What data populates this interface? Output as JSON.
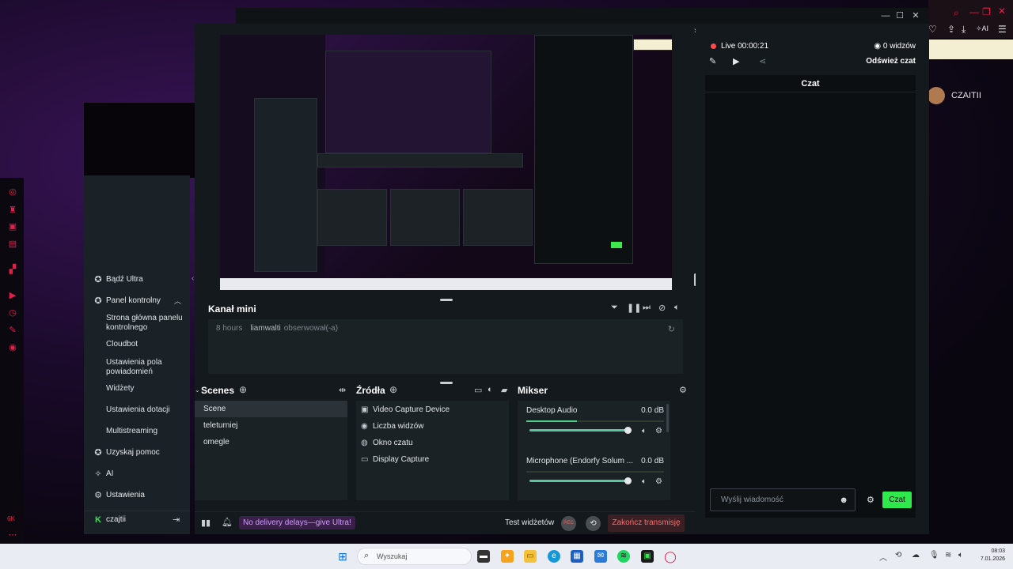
{
  "sidebar": {
    "items": [
      {
        "icon": "ultra-icon",
        "label": "Bądź Ultra"
      },
      {
        "icon": "dashboard-icon",
        "label": "Panel kontrolny"
      },
      {
        "icon": "help-icon",
        "label": "Uzyskaj pomoc"
      },
      {
        "icon": "ai-icon",
        "label": "AI"
      },
      {
        "icon": "gear-icon",
        "label": "Ustawienia"
      }
    ],
    "sub_items": [
      "Strona główna panelu kontrolnego",
      "Cloudbot",
      "Ustawienia pola powiadomień",
      "Widżety",
      "Ustawienia dotacji",
      "Multistreaming"
    ],
    "user": "czajtii"
  },
  "mini_feed": {
    "title": "Kanał mini",
    "event_time": "8 hours",
    "event_user": "liamwalti",
    "event_action": "obserwował(-a)"
  },
  "scenes": {
    "title": "Scenes",
    "items": [
      "Scene",
      "teleturniej",
      "omegle"
    ],
    "active": "Scene"
  },
  "sources": {
    "title": "Źródła",
    "items": [
      {
        "icon": "camera-icon",
        "label": "Video Capture Device"
      },
      {
        "icon": "eye-icon",
        "label": "Liczba widzów"
      },
      {
        "icon": "chat-icon",
        "label": "Okno czatu"
      },
      {
        "icon": "monitor-icon",
        "label": "Display Capture"
      }
    ]
  },
  "mixer": {
    "title": "Mikser",
    "channels": [
      {
        "name": "Desktop Audio",
        "db": "0.0 dB",
        "level": 0.37,
        "volume": 1.0
      },
      {
        "name": "Microphone (Endorfy Solum ...",
        "db": "0.0 dB",
        "level": 0.0,
        "volume": 1.0
      }
    ]
  },
  "footer": {
    "promo": "No delivery delays—give Ultra!",
    "test_widgets": "Test widżetów",
    "rec": "REC",
    "end_stream": "Zakończ transmisję"
  },
  "chat": {
    "live": "Live 00:00:21",
    "viewers": "0 widzów",
    "refresh": "Odśwież czat",
    "title": "Czat",
    "placeholder": "Wyślij wiadomość",
    "send": "Czat"
  },
  "browser": {
    "username": "CZAITII",
    "ai_label": "AI"
  },
  "left_strip": {
    "label": "6K"
  },
  "taskbar": {
    "search_placeholder": "Wyszukaj",
    "time": "08:03",
    "date": "7.01.2026"
  },
  "colors": {
    "accent_green": "#2ee84c",
    "live_red": "#ff4b4b",
    "end_red": "#ff6b6b",
    "promo_purple": "#cf9bff"
  }
}
